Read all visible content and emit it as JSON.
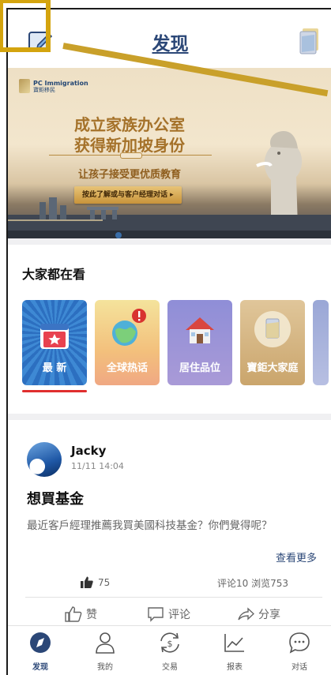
{
  "header": {
    "title": "发现"
  },
  "banner": {
    "brand_en": "PC Immigration",
    "brand_cn": "寶鉅移民",
    "headline1": "成立家族办公室",
    "headline2": "获得新加坡身份",
    "subline": "让孩子接受更优质教育",
    "cta": "按此了解或与客户经理对话 ▸"
  },
  "section": {
    "title": "大家都在看",
    "cards": [
      {
        "label": "最 新"
      },
      {
        "label": "全球热话"
      },
      {
        "label": "居住品位"
      },
      {
        "label": "寶鉅大家庭"
      }
    ]
  },
  "post": {
    "user": "Jacky",
    "time": "11/11 14:04",
    "title": "想買基金",
    "body": "最近客戶經理推薦我買美國科技基金？你們覺得呢？",
    "more": "查看更多",
    "likes": "75",
    "comments": "评论10",
    "views": "浏览753",
    "actions": {
      "like": "赞",
      "comment": "评论",
      "share": "分享"
    }
  },
  "tabs": [
    {
      "label": "发现",
      "icon": "compass-icon"
    },
    {
      "label": "我的",
      "icon": "user-icon"
    },
    {
      "label": "交易",
      "icon": "exchange-icon"
    },
    {
      "label": "报表",
      "icon": "chart-icon"
    },
    {
      "label": "对话",
      "icon": "chat-icon"
    }
  ],
  "colors": {
    "accent": "#2b4777",
    "highlight": "#d4a40e",
    "active_underline": "#e02e2e"
  }
}
